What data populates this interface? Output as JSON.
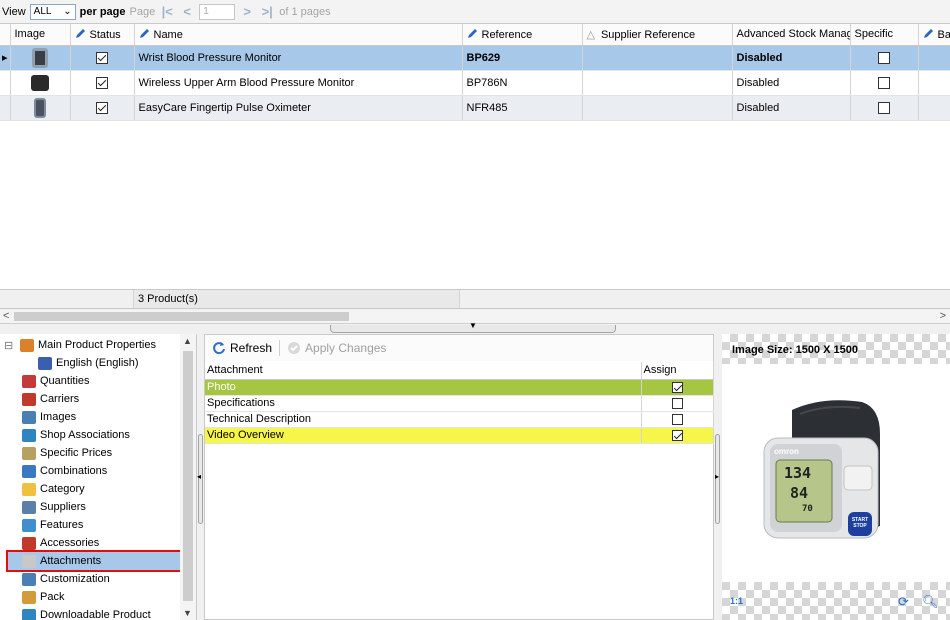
{
  "toolbar": {
    "view_label": "View",
    "view_value": "ALL",
    "per_page_label": "per page",
    "page_label": "Page",
    "page_value": "1",
    "of_pages": "of 1 pages"
  },
  "grid": {
    "headers": {
      "image": "Image",
      "status": "Status",
      "name": "Name",
      "reference": "Reference",
      "supplier_reference": "Supplier Reference",
      "advanced_stock": "Advanced Stock Manage",
      "specific": "Specific",
      "ba": "Ba"
    },
    "rows": [
      {
        "name": "Wrist Blood Pressure Monitor",
        "reference": "BP629",
        "supplier_reference": "",
        "advanced_stock": "Disabled",
        "status": true,
        "specific": false
      },
      {
        "name": "Wireless Upper Arm Blood Pressure Monitor",
        "reference": "BP786N",
        "supplier_reference": "",
        "advanced_stock": "Disabled",
        "status": true,
        "specific": false
      },
      {
        "name": "EasyCare Fingertip Pulse Oximeter",
        "reference": "NFR485",
        "supplier_reference": "",
        "advanced_stock": "Disabled",
        "status": true,
        "specific": false
      }
    ],
    "footer_count": "3 Product(s)"
  },
  "tree": {
    "items": [
      {
        "label": "Main Product Properties",
        "icon": "box-icon",
        "color": "#d9822b"
      },
      {
        "label": "English (English)",
        "icon": "flag-us-icon",
        "color": "#3b5fb0"
      },
      {
        "label": "Quantities",
        "icon": "numbers-icon",
        "color": "#c43a3a"
      },
      {
        "label": "Carriers",
        "icon": "truck-icon",
        "color": "#c0392b"
      },
      {
        "label": "Images",
        "icon": "image-icon",
        "color": "#4a7fb5"
      },
      {
        "label": "Shop Associations",
        "icon": "globe-icon",
        "color": "#2e86c1"
      },
      {
        "label": "Specific Prices",
        "icon": "price-tag-icon",
        "color": "#b8a060"
      },
      {
        "label": "Combinations",
        "icon": "combinations-icon",
        "color": "#3a78c2"
      },
      {
        "label": "Category",
        "icon": "folder-icon",
        "color": "#f0c040"
      },
      {
        "label": "Suppliers",
        "icon": "supplier-icon",
        "color": "#5a7fa8"
      },
      {
        "label": "Features",
        "icon": "features-icon",
        "color": "#3e8ed0"
      },
      {
        "label": "Accessories",
        "icon": "accessories-icon",
        "color": "#c0392b"
      },
      {
        "label": "Attachments",
        "icon": "attachment-icon",
        "color": "#c8c8c8"
      },
      {
        "label": "Customization",
        "icon": "customization-icon",
        "color": "#4a7fb5"
      },
      {
        "label": "Pack",
        "icon": "pack-icon",
        "color": "#d39b3a"
      },
      {
        "label": "Downloadable Product",
        "icon": "download-icon",
        "color": "#2e86c1"
      }
    ]
  },
  "attach": {
    "refresh_label": "Refresh",
    "apply_label": "Apply Changes",
    "col_attachment": "Attachment",
    "col_assign": "Assign",
    "rows": [
      {
        "name": "Photo",
        "assigned": true
      },
      {
        "name": "Specifications",
        "assigned": false
      },
      {
        "name": "Technical Description",
        "assigned": false
      },
      {
        "name": "Video Overview",
        "assigned": true
      }
    ]
  },
  "preview": {
    "size_label": "Image Size: 1500 X 1500",
    "brand": "omron",
    "readings": [
      "134",
      "84",
      "70"
    ],
    "button_text": "START STOP"
  },
  "colors": {
    "selection": "#a8c8ea",
    "highlight_green": "#a6c641",
    "highlight_yellow": "#f6f64a",
    "red_outline": "#e01010"
  }
}
